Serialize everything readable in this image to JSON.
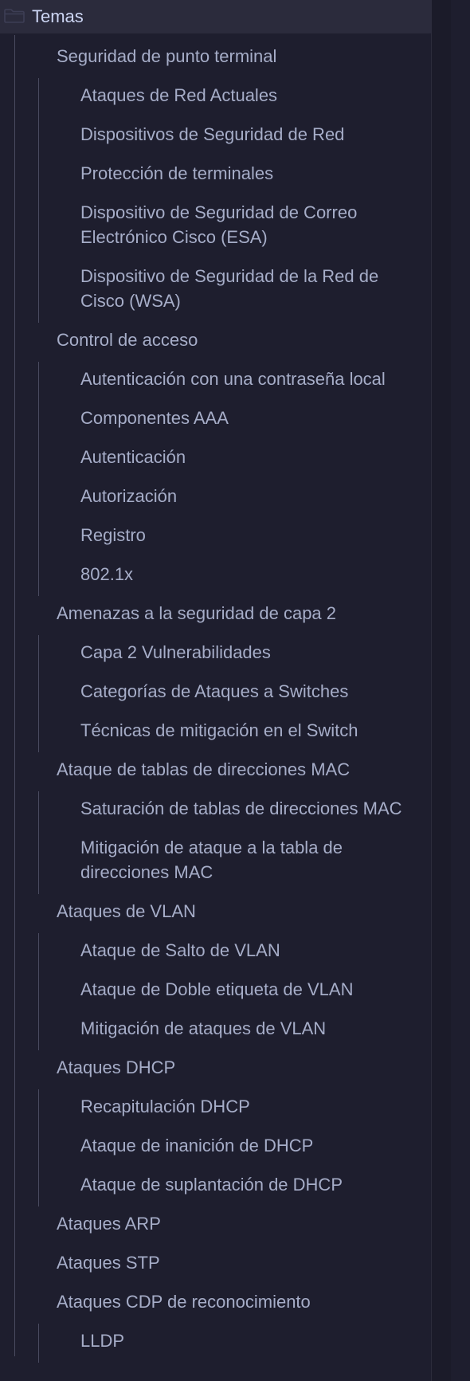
{
  "root": {
    "label": "Temas",
    "icon": "folder-icon"
  },
  "sections": [
    {
      "label": "Seguridad de punto terminal",
      "children": [
        "Ataques de Red Actuales",
        "Dispositivos de Seguridad de Red",
        "Protección de terminales",
        "Dispositivo de Seguridad de Correo Electrónico Cisco (ESA)",
        "Dispositivo de Seguridad de la Red de Cisco (WSA)"
      ]
    },
    {
      "label": "Control de acceso",
      "children": [
        "Autenticación con una contraseña local",
        "Componentes AAA",
        "Autenticación",
        "Autorización",
        "Registro",
        "802.1x"
      ]
    },
    {
      "label": "Amenazas a la seguridad de capa 2",
      "children": [
        "Capa 2 Vulnerabilidades",
        "Categorías de Ataques a Switches",
        "Técnicas de mitigación en el Switch"
      ]
    },
    {
      "label": "Ataque de tablas de direcciones MAC",
      "children": [
        "Saturación de tablas de direcciones MAC",
        "Mitigación de ataque a la tabla de direcciones MAC"
      ]
    },
    {
      "label": "Ataques de VLAN",
      "children": [
        "Ataque de Salto de VLAN",
        "Ataque de Doble etiqueta de VLAN",
        "Mitigación de ataques de VLAN"
      ]
    },
    {
      "label": "Ataques DHCP",
      "children": [
        "Recapitulación DHCP",
        "Ataque de inanición de DHCP",
        "Ataque de suplantación de DHCP"
      ]
    },
    {
      "label": "Ataques ARP",
      "children": []
    },
    {
      "label": "Ataques STP",
      "children": []
    },
    {
      "label": "Ataques CDP de reconocimiento",
      "children": [
        "LLDP"
      ]
    }
  ],
  "colors": {
    "background": "#1e1e2e",
    "root_highlight": "#2b2b3c",
    "text": "#a6adc8",
    "root_text": "#cdd6f4",
    "guide": "#4a4b60"
  }
}
